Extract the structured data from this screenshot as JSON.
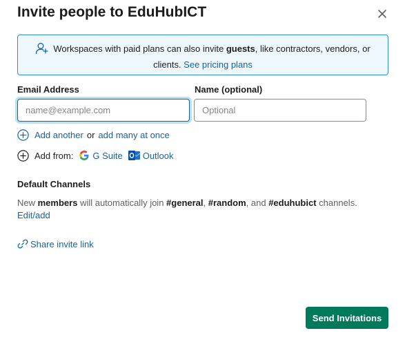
{
  "dialog": {
    "title": "Invite people to EduHubICT",
    "close_icon": "close-icon"
  },
  "info": {
    "icon": "add-user-icon",
    "text_before": "Workspaces with paid plans can also invite ",
    "text_bold": "guests",
    "text_after": ", like contractors, vendors, or clients. ",
    "link": "See pricing plans"
  },
  "form": {
    "email_label": "Email Address",
    "email_placeholder": "name@example.com",
    "email_value": "",
    "name_label": "Name (optional)",
    "name_placeholder": "Optional",
    "name_value": ""
  },
  "add_row": {
    "icon": "circle-plus-icon",
    "add_another": "Add another",
    "or": "or",
    "add_many": "add many at once"
  },
  "add_from": {
    "icon": "circle-plus-icon",
    "label": "Add from:",
    "gsuite_icon": "google-icon",
    "gsuite": "G Suite",
    "outlook_icon": "outlook-icon",
    "outlook": "Outlook"
  },
  "channels": {
    "title": "Default Channels",
    "t1": "New ",
    "b1": "members",
    "t2": " will automatically join ",
    "b2": "#general",
    "t3": ", ",
    "b3": "#random",
    "t4": ", and ",
    "b4": "#eduhubict",
    "t5": " channels.",
    "edit_link": "Edit/add"
  },
  "share": {
    "icon": "link-icon",
    "label": "Share invite link"
  },
  "footer": {
    "send_label": "Send Invitations"
  },
  "colors": {
    "link": "#1264a3",
    "primary_button": "#007a5a",
    "info_bg": "#eef7fc",
    "info_border": "#2a8fcc"
  }
}
